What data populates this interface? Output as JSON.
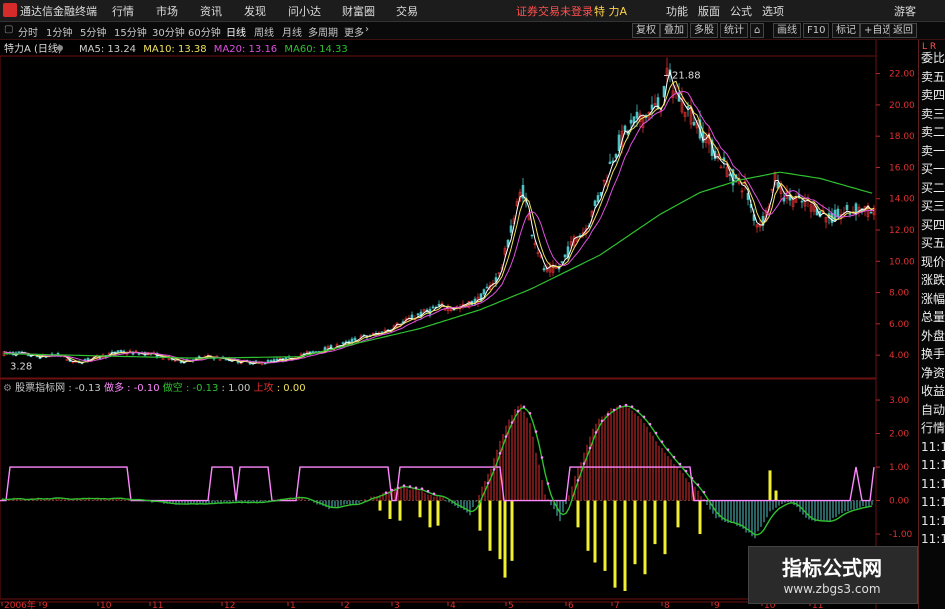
{
  "app": {
    "title": "通达信金融终端",
    "menu": [
      "行情",
      "市场",
      "资讯",
      "发现",
      "问小达",
      "财富圈",
      "交易"
    ],
    "alert": "证券交易未登录",
    "stock_name": "特 力A",
    "right_menu": [
      "功能",
      "版面",
      "公式",
      "选项"
    ],
    "guest": "游客"
  },
  "periods": [
    "分时",
    "1分钟",
    "5分钟",
    "15分钟",
    "30分钟",
    "60分钟",
    "日线",
    "周线",
    "月线",
    "多周期",
    "更多"
  ],
  "tools": [
    "复权",
    "叠加",
    "多股",
    "统计",
    "画线",
    "F10",
    "标记",
    "+自选",
    "返回"
  ],
  "chart_header": {
    "name": "特力A",
    "period": "(日线)",
    "ma5": "MA5: 13.24",
    "ma10": "MA10: 13.38",
    "ma20": "MA20: 13.16",
    "ma60": "MA60: 14.33"
  },
  "price_axis": [
    "22.00",
    "20.00",
    "18.00",
    "16.00",
    "14.00",
    "12.00",
    "10.00",
    "8.00",
    "6.00",
    "4.00"
  ],
  "annotations": {
    "high": "21.88",
    "low": "3.28"
  },
  "indicator": {
    "name": "股票指标网",
    "v1": ": -0.13",
    "l2": "做多",
    "v2": ": -0.10",
    "l3": "做空",
    "v3": ": -0.13",
    "v4": ": 1.00",
    "l5": "上攻",
    "v5": ": 0.00"
  },
  "ind_axis": [
    "3.00",
    "2.00",
    "1.00",
    "0.00",
    "-1.00"
  ],
  "date_axis": [
    "2006年",
    "9",
    "10",
    "11",
    "12",
    "1",
    "2",
    "3",
    "4",
    "5",
    "6",
    "7",
    "8",
    "9",
    "10",
    "11"
  ],
  "sidebar": [
    "委比",
    "卖五",
    "卖四",
    "卖三",
    "卖二",
    "卖一",
    "买一",
    "买二",
    "买三",
    "买四",
    "买五",
    "现价",
    "涨跌",
    "涨幅",
    "总量",
    "外盘",
    "换手",
    "净资",
    "收益",
    "自动",
    "行情",
    "11:1",
    "11:1",
    "11:1",
    "11:1",
    "11:1",
    "11:1"
  ],
  "sidebar_top": "L R",
  "watermark": {
    "line1": "指标公式网",
    "line2": "www.zbgs3.com"
  },
  "colors": {
    "bg": "#000000",
    "grid": "#6b1010",
    "up": "#e03030",
    "down": "#4fc3c3",
    "ma5": "#ffffff",
    "ma10": "#f0e060",
    "ma20": "#e050e0",
    "ma60": "#30c030",
    "yellow": "#f0f030",
    "pink": "#ff88ff"
  },
  "chart_data": [
    {
      "type": "candlestick",
      "title": "特力A (日线)",
      "y_axis_ticks": [
        4,
        6,
        8,
        10,
        12,
        14,
        16,
        18,
        20,
        22
      ],
      "ylim": [
        2.6,
        23
      ],
      "x_ticks": [
        "2006年",
        "9",
        "10",
        "11",
        "12",
        "1",
        "2",
        "3",
        "4",
        "5",
        "6",
        "7",
        "8",
        "9",
        "10",
        "11"
      ],
      "knots": [
        [
          0,
          4.1
        ],
        [
          20,
          4.1
        ],
        [
          40,
          3.9
        ],
        [
          60,
          4.0
        ],
        [
          75,
          3.5
        ],
        [
          100,
          3.9
        ],
        [
          120,
          4.2
        ],
        [
          150,
          4.1
        ],
        [
          180,
          3.6
        ],
        [
          210,
          3.9
        ],
        [
          240,
          3.6
        ],
        [
          260,
          3.5
        ],
        [
          290,
          3.8
        ],
        [
          320,
          4.3
        ],
        [
          340,
          4.6
        ],
        [
          360,
          5.1
        ],
        [
          380,
          5.4
        ],
        [
          400,
          6.0
        ],
        [
          420,
          6.6
        ],
        [
          440,
          7.1
        ],
        [
          460,
          7.0
        ],
        [
          480,
          7.6
        ],
        [
          500,
          9.2
        ],
        [
          515,
          13.0
        ],
        [
          522,
          14.8
        ],
        [
          532,
          12.0
        ],
        [
          545,
          9.3
        ],
        [
          560,
          9.6
        ],
        [
          575,
          11.5
        ],
        [
          585,
          12.0
        ],
        [
          595,
          13.5
        ],
        [
          605,
          15.2
        ],
        [
          615,
          17.1
        ],
        [
          630,
          18.6
        ],
        [
          645,
          19.3
        ],
        [
          660,
          20.0
        ],
        [
          668,
          21.88
        ],
        [
          675,
          20.8
        ],
        [
          690,
          19.5
        ],
        [
          705,
          18.0
        ],
        [
          720,
          16.5
        ],
        [
          735,
          15.2
        ],
        [
          745,
          14.8
        ],
        [
          752,
          13.2
        ],
        [
          758,
          12.3
        ],
        [
          765,
          12.8
        ],
        [
          775,
          15.2
        ],
        [
          785,
          14.2
        ],
        [
          800,
          13.8
        ],
        [
          815,
          13.5
        ],
        [
          830,
          12.7
        ],
        [
          845,
          13.1
        ],
        [
          860,
          13.4
        ],
        [
          875,
          13.0
        ]
      ],
      "ma60": [
        [
          0,
          4.1
        ],
        [
          200,
          3.8
        ],
        [
          300,
          3.9
        ],
        [
          360,
          4.8
        ],
        [
          420,
          5.7
        ],
        [
          480,
          6.9
        ],
        [
          530,
          8.2
        ],
        [
          600,
          10.4
        ],
        [
          660,
          13.0
        ],
        [
          700,
          14.4
        ],
        [
          740,
          15.2
        ],
        [
          780,
          15.7
        ],
        [
          820,
          15.3
        ],
        [
          875,
          14.3
        ]
      ],
      "ma_values": {
        "MA5": 13.24,
        "MA10": 13.38,
        "MA20": 13.16,
        "MA60": 14.33
      },
      "high": 21.88,
      "low": 3.28
    },
    {
      "type": "bar",
      "title": "股票指标网",
      "y_axis_ticks": [
        -1,
        0,
        1,
        2,
        3
      ],
      "ylim": [
        -2.7,
        3.3
      ],
      "knots": [
        [
          0,
          0.05
        ],
        [
          120,
          0.05
        ],
        [
          180,
          -0.1
        ],
        [
          260,
          -0.05
        ],
        [
          300,
          0.1
        ],
        [
          330,
          -0.25
        ],
        [
          360,
          -0.05
        ],
        [
          400,
          0.45
        ],
        [
          440,
          0.1
        ],
        [
          470,
          -0.4
        ],
        [
          490,
          0.9
        ],
        [
          505,
          2.2
        ],
        [
          520,
          2.95
        ],
        [
          530,
          2.3
        ],
        [
          545,
          0.2
        ],
        [
          560,
          -0.6
        ],
        [
          575,
          0.7
        ],
        [
          595,
          2.3
        ],
        [
          612,
          2.75
        ],
        [
          625,
          2.85
        ],
        [
          645,
          2.3
        ],
        [
          665,
          1.4
        ],
        [
          680,
          0.9
        ],
        [
          700,
          0.2
        ],
        [
          715,
          -0.5
        ],
        [
          735,
          -0.7
        ],
        [
          755,
          -1.1
        ],
        [
          770,
          -0.3
        ],
        [
          790,
          0.0
        ],
        [
          810,
          -0.6
        ],
        [
          830,
          -0.6
        ],
        [
          850,
          -0.25
        ],
        [
          875,
          -0.13
        ]
      ],
      "yellow_bars": [
        [
          380,
          -0.3
        ],
        [
          390,
          -0.55
        ],
        [
          400,
          -0.6
        ],
        [
          420,
          -0.5
        ],
        [
          430,
          -0.8
        ],
        [
          438,
          -0.75
        ],
        [
          480,
          -0.9
        ],
        [
          490,
          -1.5
        ],
        [
          500,
          -1.75
        ],
        [
          505,
          -2.3
        ],
        [
          512,
          -1.8
        ],
        [
          578,
          -0.8
        ],
        [
          588,
          -1.5
        ],
        [
          595,
          -1.85
        ],
        [
          605,
          -2.1
        ],
        [
          615,
          -2.6
        ],
        [
          625,
          -2.7
        ],
        [
          635,
          -1.9
        ],
        [
          645,
          -2.2
        ],
        [
          655,
          -1.3
        ],
        [
          665,
          -1.6
        ],
        [
          678,
          -0.8
        ],
        [
          700,
          -1.0
        ],
        [
          770,
          0.9
        ],
        [
          776,
          0.3
        ]
      ],
      "pink_segments": [
        [
          10,
          127
        ],
        [
          212,
          232
        ],
        [
          240,
          268
        ],
        [
          300,
          388
        ],
        [
          400,
          500
        ],
        [
          570,
          690
        ]
      ],
      "legend": {
        "做多": -0.1,
        "做空": -0.13,
        "上攻": 0.0
      }
    }
  ]
}
